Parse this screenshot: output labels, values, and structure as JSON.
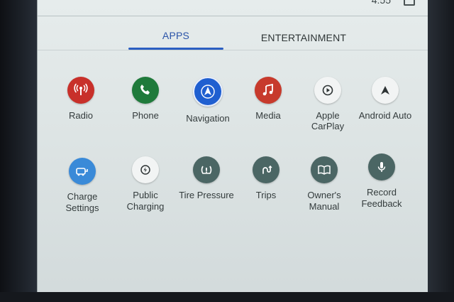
{
  "status_bar": {
    "clock": "4:55"
  },
  "tabs": [
    {
      "label": "APPS",
      "selected": true
    },
    {
      "label": "ENTERTAINMENT",
      "selected": false
    }
  ],
  "apps": [
    {
      "label": "Radio",
      "icon": "radio-tower-icon",
      "color": "#c8302a"
    },
    {
      "label": "Phone",
      "icon": "phone-icon",
      "color": "#1f7a3b"
    },
    {
      "label": "Navigation",
      "icon": "navigation-arrow-icon",
      "color": "#1f5fd0"
    },
    {
      "label": "Media",
      "icon": "music-note-icon",
      "color": "#c73a2c"
    },
    {
      "label": "Apple\nCarPlay",
      "icon": "carplay-icon",
      "color": "#f2f4f4"
    },
    {
      "label": "Android Auto",
      "icon": "android-auto-icon",
      "color": "#f2f4f4"
    },
    {
      "label": "Charge\nSettings",
      "icon": "charge-settings-icon",
      "color": "#3a8ad8"
    },
    {
      "label": "Public\nCharging",
      "icon": "public-charging-icon",
      "color": "#f2f4f4"
    },
    {
      "label": "Tire Pressure",
      "icon": "tire-pressure-icon",
      "color": "#4b6664"
    },
    {
      "label": "Trips",
      "icon": "trips-icon",
      "color": "#4b6664"
    },
    {
      "label": "Owner's\nManual",
      "icon": "manual-book-icon",
      "color": "#4b6664"
    },
    {
      "label": "Record\nFeedback",
      "icon": "microphone-icon",
      "color": "#4b6664"
    }
  ],
  "colors": {
    "tab_accent": "#2b5fc2",
    "screen_bg": "#e2e8e8"
  }
}
